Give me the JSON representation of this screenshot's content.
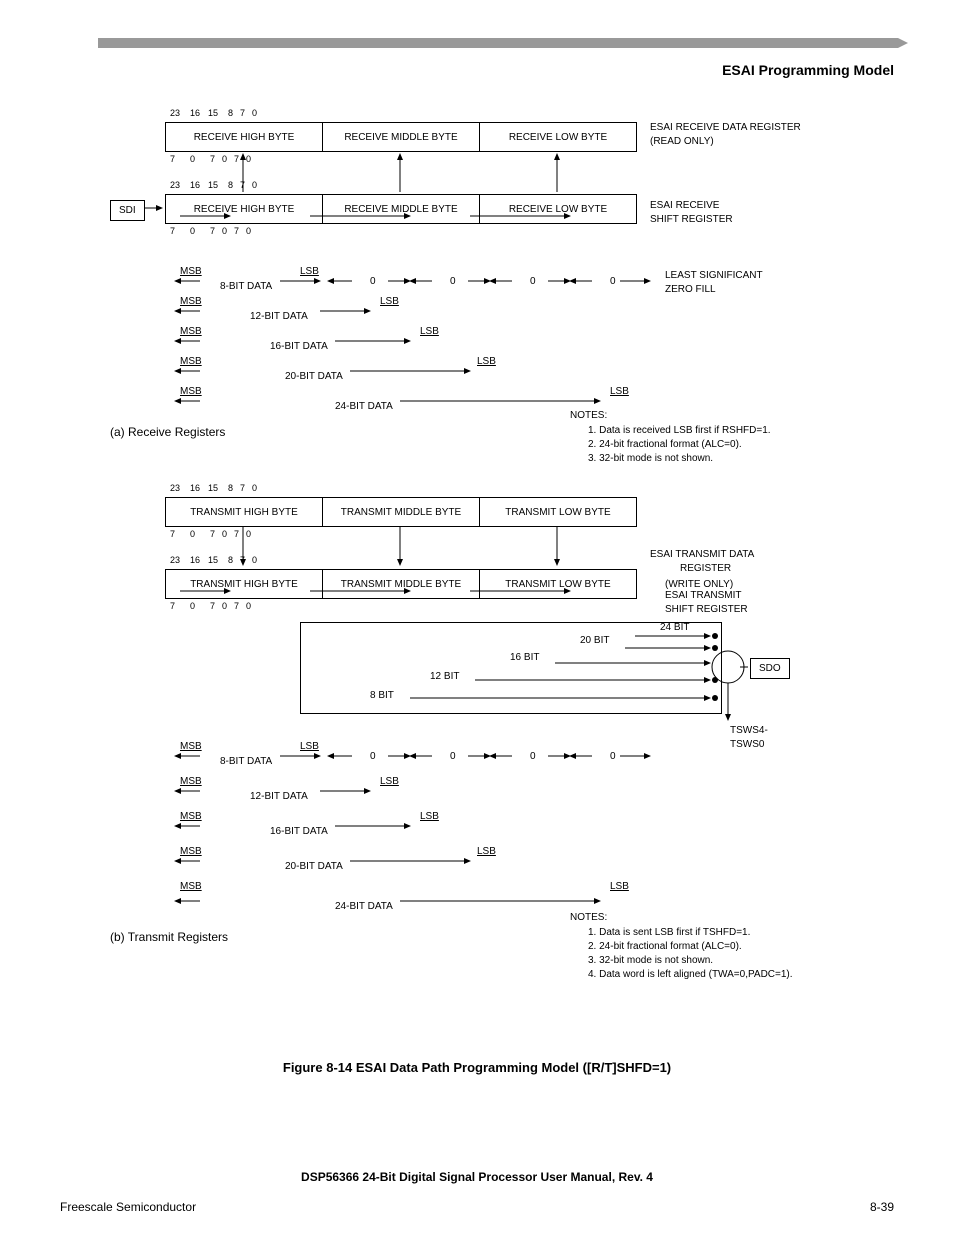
{
  "header": {
    "title": "ESAI Programming Model"
  },
  "rx": {
    "bits_top": [
      "23",
      "16",
      "15",
      "8",
      "7",
      "0"
    ],
    "bits_bot": [
      "7",
      "0",
      "7",
      "0",
      "7",
      "0"
    ],
    "reg1": [
      "RECEIVE HIGH BYTE",
      "RECEIVE MIDDLE BYTE",
      "RECEIVE LOW BYTE"
    ],
    "reg1_label": "ESAI RECEIVE DATA REGISTER",
    "reg1_sub": "(READ ONLY)",
    "reg2": [
      "RECEIVE HIGH BYTE",
      "RECEIVE MIDDLE BYTE",
      "RECEIVE LOW BYTE"
    ],
    "reg2_label": "ESAI RECEIVE",
    "reg2_sub": "SHIFT REGISTER",
    "sdi": "SDI",
    "msb": "MSB",
    "lsb": "LSB",
    "zero": "0",
    "zerofill1": "LEAST SIGNIFICANT",
    "zerofill2": "ZERO FILL",
    "widths": [
      "8-BIT DATA",
      "12-BIT DATA",
      "16-BIT DATA",
      "20-BIT DATA",
      "24-BIT DATA"
    ],
    "caption": "(a) Receive Registers",
    "notes_title": "NOTES:",
    "notes": [
      "1.  Data is received LSB first if RSHFD=1.",
      "2.  24-bit fractional format (ALC=0).",
      "3.  32-bit mode is not shown."
    ]
  },
  "tx": {
    "bits_top": [
      "23",
      "16",
      "15",
      "8",
      "7",
      "0"
    ],
    "bits_bot": [
      "7",
      "0",
      "7",
      "0",
      "7",
      "0"
    ],
    "reg1": [
      "TRANSMIT HIGH BYTE",
      "TRANSMIT MIDDLE BYTE",
      "TRANSMIT LOW BYTE"
    ],
    "reg1_label1": "ESAI TRANSMIT DATA",
    "reg1_label2": "REGISTER",
    "reg1_sub": "(WRITE ONLY)",
    "reg2": [
      "TRANSMIT HIGH BYTE",
      "TRANSMIT MIDDLE BYTE",
      "TRANSMIT LOW BYTE"
    ],
    "reg2_label": "ESAI TRANSMIT",
    "reg2_sub": "SHIFT REGISTER",
    "sdo": "SDO",
    "tsws": "TSWS4-",
    "tsws2": "TSWS0",
    "sizes": [
      "24 BIT",
      "20 BIT",
      "16 BIT",
      "12 BIT",
      "8 BIT"
    ],
    "widths": [
      "8-BIT DATA",
      "12-BIT DATA",
      "16-BIT DATA",
      "20-BIT DATA",
      "24-BIT DATA"
    ],
    "caption": "(b) Transmit Registers",
    "notes_title": "NOTES:",
    "notes": [
      "1.  Data is sent LSB first if TSHFD=1.",
      "2.  24-bit fractional format (ALC=0).",
      "3.  32-bit mode is not shown.",
      "4.  Data word is left aligned (TWA=0,PADC=1)."
    ]
  },
  "figure": "Figure 8-14  ESAI Data Path Programming Model ([R/T]SHFD=1)",
  "manual": "DSP56366 24-Bit Digital Signal Processor User Manual, Rev. 4",
  "footer": {
    "left": "Freescale Semiconductor",
    "right": "8-39"
  }
}
